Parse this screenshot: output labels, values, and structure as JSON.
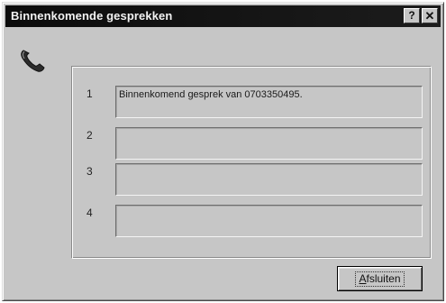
{
  "window": {
    "title": "Binnenkomende gesprekken",
    "help_glyph": "?",
    "close_glyph": "✕"
  },
  "icon": "telephone-handset-icon",
  "calls": [
    {
      "number": "1",
      "text": "Binnenkomend gesprek van 0703350495."
    },
    {
      "number": "2",
      "text": ""
    },
    {
      "number": "3",
      "text": ""
    },
    {
      "number": "4",
      "text": ""
    }
  ],
  "buttons": {
    "close_mnemonic": "A",
    "close_rest": "fsluiten"
  },
  "colors": {
    "dialog_face": "#c6c6c6",
    "titlebar": "#0c0c0c"
  }
}
